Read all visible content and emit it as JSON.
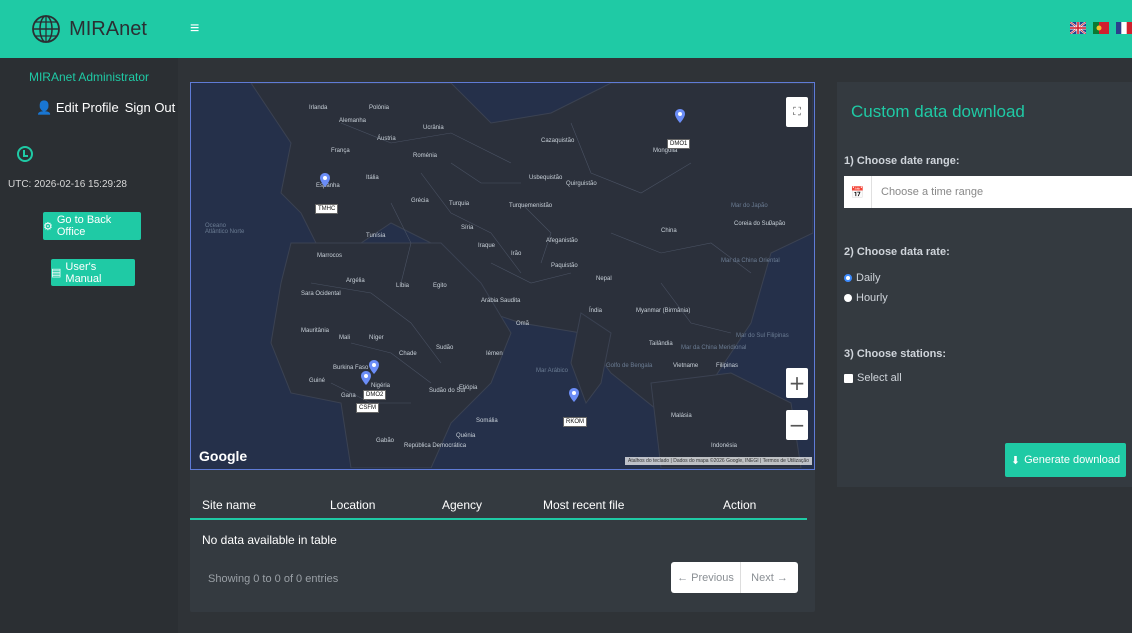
{
  "header": {
    "brand": "MIRAnet",
    "menu_icon": "≡"
  },
  "sidebar": {
    "user": "MIRAnet Administrator",
    "edit_profile": "Edit Profile",
    "sign_out": "Sign Out",
    "utc": "UTC: 2026-02-16 15:29:28",
    "back_office": "Go to Back Office",
    "manual": "User's Manual"
  },
  "map": {
    "google": "Google",
    "attribution": "Atalhos do teclado | Dados do mapa ©2026 Google, INEGI | Termos de Utilização",
    "labels": {
      "irlanda": "Irlanda",
      "polonia": "Polónia",
      "alemanha": "Alemanha",
      "ucrania": "Ucrânia",
      "franca": "França",
      "austria": "Áustria",
      "romenia": "Roménia",
      "espanha": "Espanha",
      "italia": "Itália",
      "grecia": "Grécia",
      "turquia": "Turquia",
      "cazaquistao": "Cazaquistão",
      "mongolia": "Mongólia",
      "usbequistao": "Usbequistão",
      "quirguistao": "Quirguistão",
      "turquemenistao": "Turquemenistão",
      "siria": "Síria",
      "iraque": "Iraque",
      "ira": "Irão",
      "afeganistao": "Afeganistão",
      "paquistao": "Paquistão",
      "china": "China",
      "coreia": "Coreia do Sul",
      "japao": "Japão",
      "tunisia": "Tunísia",
      "marrocos": "Marrocos",
      "argelia": "Argélia",
      "libia": "Líbia",
      "egito": "Egito",
      "arabia": "Arábia Saudita",
      "oma": "Omã",
      "india": "Índia",
      "nepal": "Nepal",
      "myanmar": "Myanmar (Birmânia)",
      "tailandia": "Tailândia",
      "vietname": "Vietname",
      "filipinas": "Filipinas",
      "malasia": "Malásia",
      "indonesia": "Indonésia",
      "sara": "Sara Ocidental",
      "mauritania": "Mauritânia",
      "mali": "Mali",
      "niger": "Níger",
      "chade": "Chade",
      "sudao": "Sudão",
      "iemen": "Iémen",
      "etiopia": "Etiópia",
      "somalia": "Somália",
      "nigeria": "Nigéria",
      "gana": "Gana",
      "guine": "Guiné",
      "burkina": "Burkina Faso",
      "sudao_sul": "Sudão do Sul",
      "quenia": "Quénia",
      "gabao": "Gabão",
      "republica": "República Democrática",
      "ocean_atl": "Oceano Atlântico Norte",
      "mar_arabia": "Mar Arábico",
      "golfo_bengala": "Golfo de Bengala",
      "mar_china": "Mar da China Meridional",
      "mar_japao": "Mar do Japão",
      "mar_china_or": "Mar da China Oriental",
      "mar_sul": "Mar do Sul Filipinas"
    },
    "markers": [
      {
        "label": "DMO1"
      },
      {
        "label": "TMHC"
      },
      {
        "label": "DMO2"
      },
      {
        "label": "CSFM"
      },
      {
        "label": "RKOM"
      }
    ]
  },
  "table": {
    "columns": [
      "Site name",
      "Location",
      "Agency",
      "Most recent file",
      "Action"
    ],
    "empty": "No data available in table",
    "showing": "Showing 0 to 0 of 0 entries",
    "prev": "← Previous",
    "next": "Next →"
  },
  "download": {
    "title": "Custom data download",
    "step1": "1) Choose date range:",
    "date_placeholder": "Choose a time range",
    "step2": "2) Choose data rate:",
    "daily": "Daily",
    "hourly": "Hourly",
    "step3": "3) Choose stations:",
    "select_all": "Select all",
    "generate": "Generate download"
  },
  "colors": {
    "accent": "#1fcaa5",
    "map_water": "#25304a",
    "map_land": "#2a2f3a"
  }
}
